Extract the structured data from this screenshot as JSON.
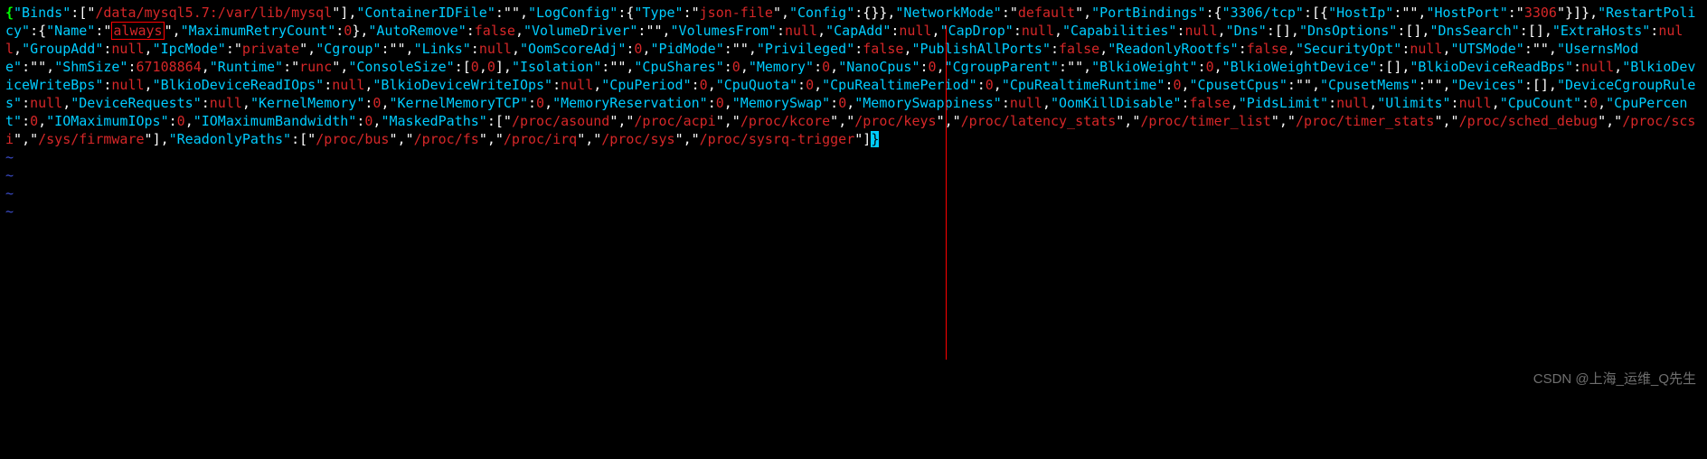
{
  "watermark": "CSDN @上海_运维_Q先生",
  "json_config": {
    "Binds": [
      "/data/mysql5.7:/var/lib/mysql"
    ],
    "ContainerIDFile": "",
    "LogConfig": {
      "Type": "json-file",
      "Config": {}
    },
    "NetworkMode": "default",
    "PortBindings": {
      "3306/tcp": [
        {
          "HostIp": "",
          "HostPort": "3306"
        }
      ]
    },
    "RestartPolicy": {
      "Name": "always",
      "MaximumRetryCount": 0
    },
    "AutoRemove": false,
    "VolumeDriver": "",
    "VolumesFrom": null,
    "CapAdd": null,
    "CapDrop": null,
    "Capabilities": null,
    "Dns": [],
    "DnsOptions": [],
    "DnsSearch": [],
    "ExtraHosts": null,
    "GroupAdd": null,
    "IpcMode": "private",
    "Cgroup": "",
    "Links": null,
    "OomScoreAdj": 0,
    "PidMode": "",
    "Privileged": false,
    "PublishAllPorts": false,
    "ReadonlyRootfs": false,
    "SecurityOpt": null,
    "UTSMode": "",
    "UsernsMode": "",
    "ShmSize": 67108864,
    "Runtime": "runc",
    "ConsoleSize": [
      0,
      0
    ],
    "Isolation": "",
    "CpuShares": 0,
    "Memory": 0,
    "NanoCpus": 0,
    "CgroupParent": "",
    "BlkioWeight": 0,
    "BlkioWeightDevice": [],
    "BlkioDeviceReadBps": null,
    "BlkioDeviceWriteBps": null,
    "BlkioDeviceReadIOps": null,
    "BlkioDeviceWriteIOps": null,
    "CpuPeriod": 0,
    "CpuQuota": 0,
    "CpuRealtimePeriod": 0,
    "CpuRealtimeRuntime": 0,
    "CpusetCpus": "",
    "CpusetMems": "",
    "Devices": [],
    "DeviceCgroupRules": null,
    "DeviceRequests": null,
    "KernelMemory": 0,
    "KernelMemoryTCP": 0,
    "MemoryReservation": 0,
    "MemorySwap": 0,
    "MemorySwappiness": null,
    "OomKillDisable": false,
    "PidsLimit": null,
    "Ulimits": null,
    "CpuCount": 0,
    "CpuPercent": 0,
    "IOMaximumIOps": 0,
    "IOMaximumBandwidth": 0,
    "MaskedPaths": [
      "/proc/asound",
      "/proc/acpi",
      "/proc/kcore",
      "/proc/keys",
      "/proc/latency_stats",
      "/proc/timer_list",
      "/proc/timer_stats",
      "/proc/sched_debug",
      "/proc/scsi",
      "/sys/firmware"
    ],
    "ReadonlyPaths": [
      "/proc/bus",
      "/proc/fs",
      "/proc/irq",
      "/proc/sys",
      "/proc/sysrq-trigger"
    ]
  },
  "tilde_lines": [
    "~",
    "~",
    "~",
    "~"
  ],
  "highlight": {
    "boxed_value": "always",
    "cursor_char": "}"
  }
}
